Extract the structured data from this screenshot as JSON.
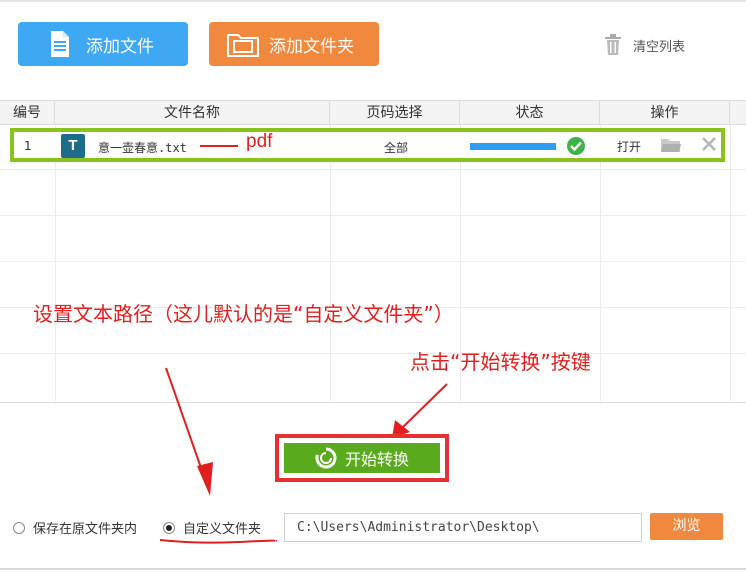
{
  "toolbar": {
    "add_file_label": "添加文件",
    "add_folder_label": "添加文件夹",
    "clear_list_label": "清空列表"
  },
  "table": {
    "headers": [
      "编号",
      "文件名称",
      "页码选择",
      "状态",
      "操作"
    ],
    "rows": [
      {
        "index": "1",
        "icon_letter": "T",
        "file_name": "意一壶春意.txt",
        "target_format": "pdf",
        "pages": "全部",
        "progress": 1.0,
        "status_icon": "check-circle-icon",
        "open_label": "打开"
      }
    ]
  },
  "annotations": {
    "note_path": "设置文本路径（这儿默认的是“自定义文件夹”）",
    "note_start": "点击“开始转换”按键"
  },
  "start_button": {
    "label": "开始转换"
  },
  "output": {
    "option_original": "保存在原文件夹内",
    "option_custom": "自定义文件夹",
    "selected": "custom",
    "path_value": "C:\\Users\\Administrator\\Desktop\\",
    "browse_label": "浏览"
  },
  "colors": {
    "blue": "#3ea8f3",
    "orange": "#f0893d",
    "green": "#5aaa1e",
    "highlight_green": "#8ac21d",
    "annotation_red": "#e02020"
  }
}
